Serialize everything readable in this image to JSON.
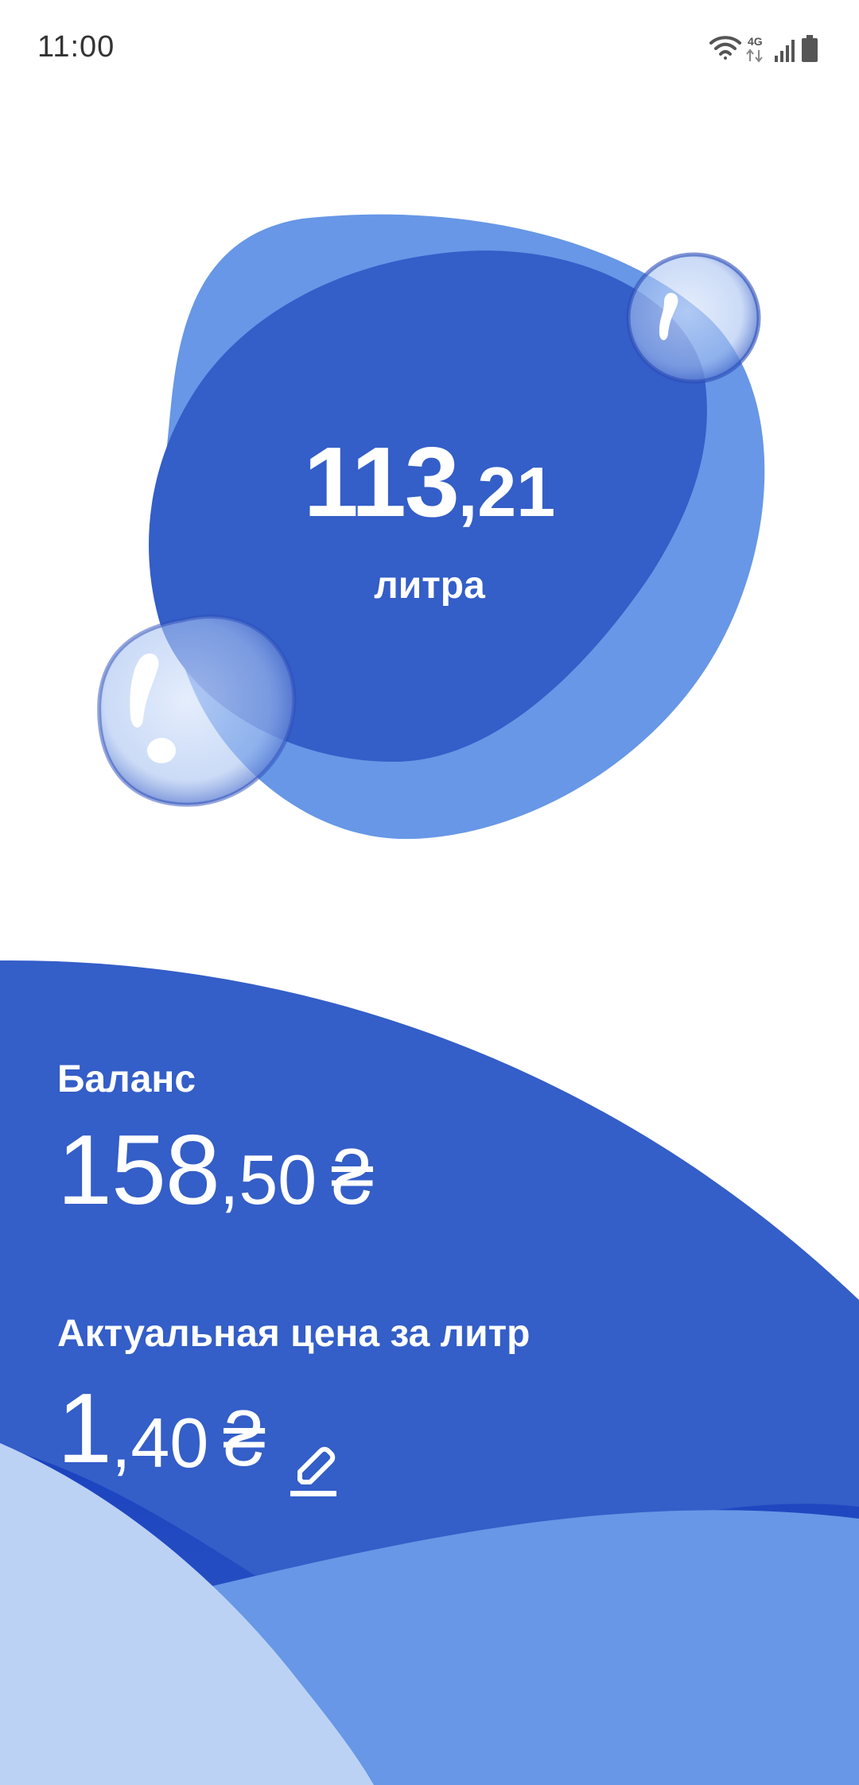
{
  "status_bar": {
    "time": "11:00",
    "network_label": "4G",
    "icons": [
      "wifi-icon",
      "network-4g-icon",
      "signal-icon",
      "battery-icon"
    ]
  },
  "meter": {
    "liters_int": "113",
    "liters_dec": ",21",
    "unit": "литра"
  },
  "balance": {
    "label": "Баланс",
    "value_int": "158",
    "value_dec": ",50",
    "currency": "₴"
  },
  "price": {
    "label": "Актуальная цена за литр",
    "value_int": "1",
    "value_dec": ",40",
    "currency": "₴",
    "edit_icon": "edit-pencil-icon"
  },
  "colors": {
    "primary": "#345EC8",
    "secondary": "#6797E6",
    "light": "#BCD2F4",
    "deep": "#0A2FB8"
  }
}
